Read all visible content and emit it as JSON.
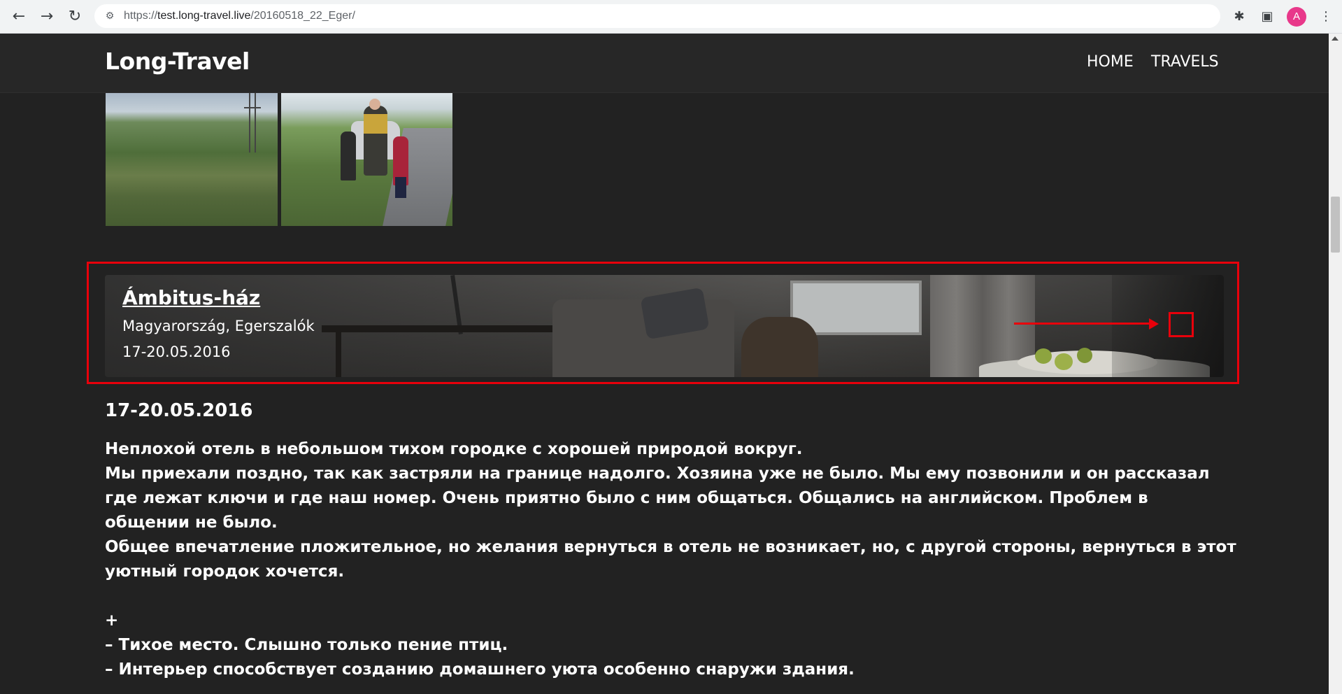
{
  "browser": {
    "url_scheme": "https://",
    "url_host": "test.long-travel.live",
    "url_path": "/20160518_22_Eger/",
    "profile_initial": "A"
  },
  "site": {
    "brand": "Long-Travel",
    "nav": [
      "HOME",
      "TRAVELS"
    ]
  },
  "hotel": {
    "name": "Ámbitus-ház",
    "location": "Magyarország, Egerszalók",
    "dates": "17-20.05.2016"
  },
  "article": {
    "date_heading": "17-20.05.2016",
    "lines": [
      "Неплохой отель в небольшом тихом городке с хорошей природой вокруг.",
      "Мы приехали поздно, так как застряли на границе надолго. Хозяина уже не было. Мы ему позвонили и он рассказал где лежат ключи и где наш номер. Очень приятно было с ним общаться. Общались на английском. Проблем в общении не было.",
      "Общее впечатление пложительное, но желания вернуться в отель не возникает, но, с другой стороны, вернуться в этот уютный городок хочется.",
      "",
      "+",
      "– Тихое место. Слышно только пение птиц.",
      "– Интерьер способствует созданию домашнего уюта особенно снаружи здания."
    ]
  },
  "colors": {
    "page_bg": "#222222",
    "header_bg": "#272727",
    "annotation_red": "#e8000b"
  }
}
